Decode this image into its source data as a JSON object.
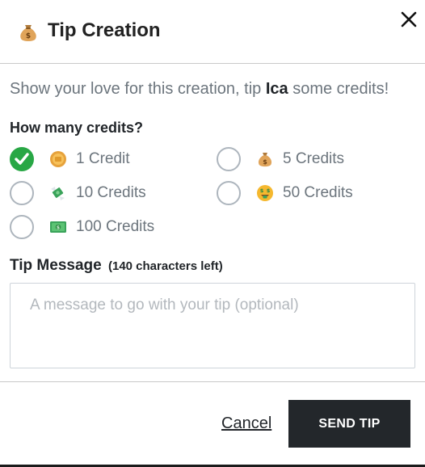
{
  "dialog": {
    "title": "Tip Creation",
    "title_icon": "money-bag-icon",
    "close_icon": "close-icon"
  },
  "intro": {
    "before": "Show your love for this creation, tip ",
    "creator": "Ica",
    "after": " some credits!"
  },
  "credits": {
    "label": "How many credits?",
    "selected": "1 Credit",
    "options": [
      {
        "label": "1 Credit",
        "icon": "coin-icon",
        "checked": true
      },
      {
        "label": "5 Credits",
        "icon": "money-bag-icon",
        "checked": false
      },
      {
        "label": "10 Credits",
        "icon": "money-with-wings-icon",
        "checked": false
      },
      {
        "label": "50 Credits",
        "icon": "money-mouth-face-icon",
        "checked": false
      },
      {
        "label": "100 Credits",
        "icon": "dollar-banknote-icon",
        "checked": false
      }
    ]
  },
  "message": {
    "label": "Tip Message",
    "chars_left": "(140 characters left)",
    "value": "",
    "placeholder": "A message to go with your tip (optional)"
  },
  "actions": {
    "cancel_label": "Cancel",
    "send_label": "SEND TIP"
  },
  "colors": {
    "check_green": "#28a745",
    "send_button_bg": "#23272b",
    "muted_text": "#6c757d"
  }
}
